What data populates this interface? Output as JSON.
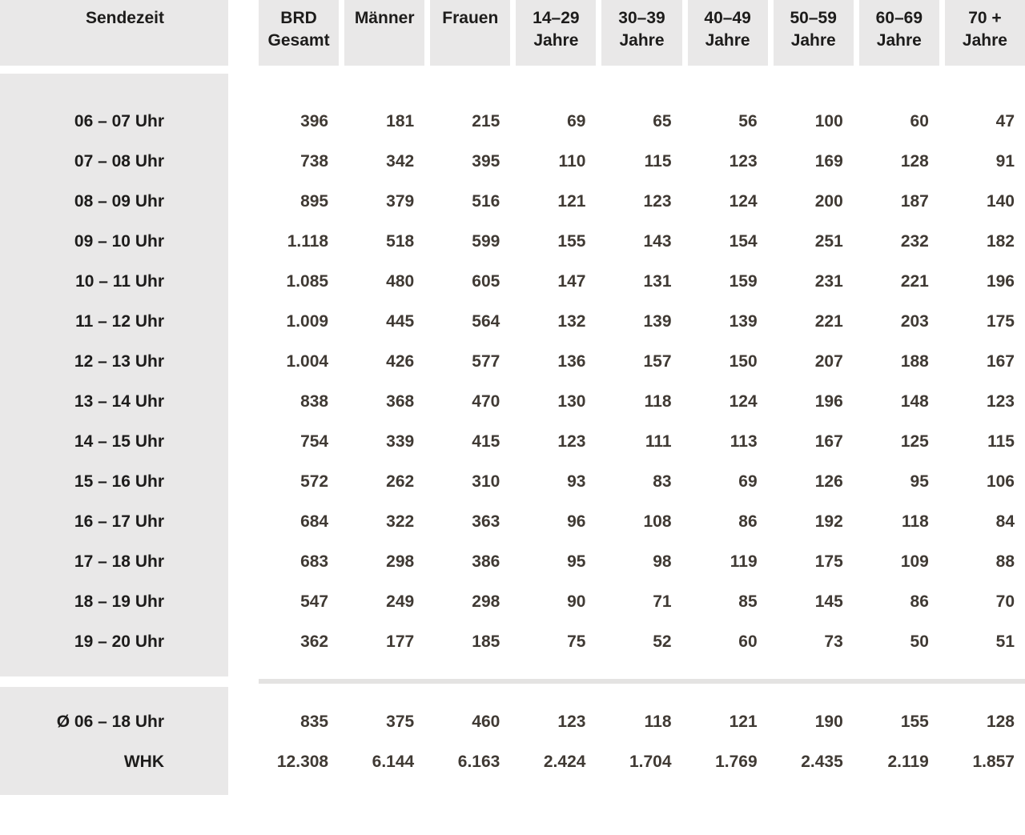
{
  "colors": {
    "page_bg": "#ffffff",
    "cell_bg": "#e9e8e8",
    "header_text": "#1d1c1b",
    "label_text": "#1d1c1b",
    "value_text": "#403a34",
    "separator": "#e4e3e2"
  },
  "chart_data": {
    "type": "table",
    "title": "",
    "corner_label": "Sendezeit",
    "columns": [
      {
        "line1": "BRD",
        "line2": "Gesamt"
      },
      {
        "line1": "Männer",
        "line2": ""
      },
      {
        "line1": "Frauen",
        "line2": ""
      },
      {
        "line1": "14–29",
        "line2": "Jahre"
      },
      {
        "line1": "30–39",
        "line2": "Jahre"
      },
      {
        "line1": "40–49",
        "line2": "Jahre"
      },
      {
        "line1": "50–59",
        "line2": "Jahre"
      },
      {
        "line1": "60–69",
        "line2": "Jahre"
      },
      {
        "line1": "70 +",
        "line2": "Jahre"
      }
    ],
    "rows": [
      {
        "label": "06 – 07 Uhr",
        "values": [
          "396",
          "181",
          "215",
          "69",
          "65",
          "56",
          "100",
          "60",
          "47"
        ]
      },
      {
        "label": "07 – 08 Uhr",
        "values": [
          "738",
          "342",
          "395",
          "110",
          "115",
          "123",
          "169",
          "128",
          "91"
        ]
      },
      {
        "label": "08 – 09 Uhr",
        "values": [
          "895",
          "379",
          "516",
          "121",
          "123",
          "124",
          "200",
          "187",
          "140"
        ]
      },
      {
        "label": "09 – 10 Uhr",
        "values": [
          "1.118",
          "518",
          "599",
          "155",
          "143",
          "154",
          "251",
          "232",
          "182"
        ]
      },
      {
        "label": "10 – 11 Uhr",
        "values": [
          "1.085",
          "480",
          "605",
          "147",
          "131",
          "159",
          "231",
          "221",
          "196"
        ]
      },
      {
        "label": "11 – 12 Uhr",
        "values": [
          "1.009",
          "445",
          "564",
          "132",
          "139",
          "139",
          "221",
          "203",
          "175"
        ]
      },
      {
        "label": "12 – 13 Uhr",
        "values": [
          "1.004",
          "426",
          "577",
          "136",
          "157",
          "150",
          "207",
          "188",
          "167"
        ]
      },
      {
        "label": "13 – 14 Uhr",
        "values": [
          "838",
          "368",
          "470",
          "130",
          "118",
          "124",
          "196",
          "148",
          "123"
        ]
      },
      {
        "label": "14 – 15 Uhr",
        "values": [
          "754",
          "339",
          "415",
          "123",
          "111",
          "113",
          "167",
          "125",
          "115"
        ]
      },
      {
        "label": "15 – 16 Uhr",
        "values": [
          "572",
          "262",
          "310",
          "93",
          "83",
          "69",
          "126",
          "95",
          "106"
        ]
      },
      {
        "label": "16 – 17 Uhr",
        "values": [
          "684",
          "322",
          "363",
          "96",
          "108",
          "86",
          "192",
          "118",
          "84"
        ]
      },
      {
        "label": "17 – 18 Uhr",
        "values": [
          "683",
          "298",
          "386",
          "95",
          "98",
          "119",
          "175",
          "109",
          "88"
        ]
      },
      {
        "label": "18 – 19 Uhr",
        "values": [
          "547",
          "249",
          "298",
          "90",
          "71",
          "85",
          "145",
          "86",
          "70"
        ]
      },
      {
        "label": "19 – 20 Uhr",
        "values": [
          "362",
          "177",
          "185",
          "75",
          "52",
          "60",
          "73",
          "50",
          "51"
        ]
      }
    ],
    "summary_rows": [
      {
        "label": "Ø 06 – 18 Uhr",
        "values": [
          "835",
          "375",
          "460",
          "123",
          "118",
          "121",
          "190",
          "155",
          "128"
        ]
      },
      {
        "label": "WHK",
        "values": [
          "12.308",
          "6.144",
          "6.163",
          "2.424",
          "1.704",
          "1.769",
          "2.435",
          "2.119",
          "1.857"
        ]
      }
    ]
  }
}
